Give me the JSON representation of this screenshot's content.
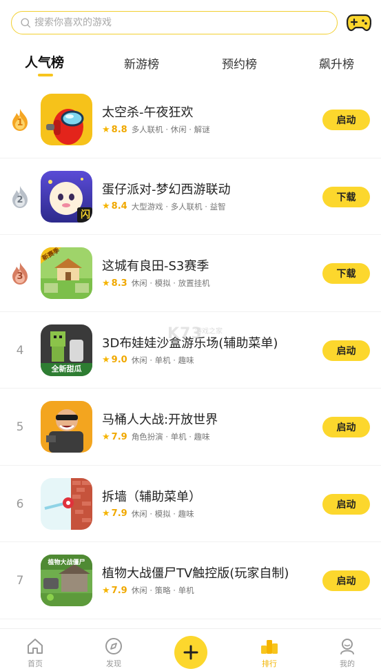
{
  "search": {
    "placeholder": "搜索你喜欢的游戏"
  },
  "tabs": [
    {
      "label": "人气榜",
      "active": true
    },
    {
      "label": "新游榜",
      "active": false
    },
    {
      "label": "预约榜",
      "active": false
    },
    {
      "label": "飙升榜",
      "active": false
    }
  ],
  "games": [
    {
      "rank": "1",
      "name": "太空杀-午夜狂欢",
      "score": "8.8",
      "tags": "多人联机 · 休闲 · 解谜",
      "action": "启动"
    },
    {
      "rank": "2",
      "name": "蛋仔派对-梦幻西游联动",
      "score": "8.4",
      "tags": "大型游戏 · 多人联机 · 益智",
      "action": "下载"
    },
    {
      "rank": "3",
      "name": "这城有良田-S3赛季",
      "score": "8.3",
      "tags": "休闲 · 模拟 · 放置挂机",
      "action": "下载"
    },
    {
      "rank": "4",
      "name": "3D布娃娃沙盒游乐场(辅助菜单)",
      "score": "9.0",
      "tags": "休闲 · 单机 · 趣味",
      "action": "启动"
    },
    {
      "rank": "5",
      "name": "马桶人大战:开放世界",
      "score": "7.9",
      "tags": "角色扮演 · 单机 · 趣味",
      "action": "启动"
    },
    {
      "rank": "6",
      "name": "拆墙（辅助菜单）",
      "score": "7.9",
      "tags": "休闲 · 模拟 · 趣味",
      "action": "启动"
    },
    {
      "rank": "7",
      "name": "植物大战僵尸TV触控版(玩家自制)",
      "score": "7.9",
      "tags": "休闲 · 策略 · 单机",
      "action": "启动"
    }
  ],
  "icon_badges": {
    "game2": "闪",
    "game3": "新赛季",
    "game4": "全新甜瓜",
    "game7": "植物大战僵尸"
  },
  "watermark": {
    "logo": "K73",
    "text": "游戏之家"
  },
  "nav": [
    {
      "label": "首页",
      "icon": "home-icon"
    },
    {
      "label": "发现",
      "icon": "compass-icon"
    },
    {
      "label": "",
      "icon": "plus-icon"
    },
    {
      "label": "排行",
      "icon": "ranking-icon",
      "active": true
    },
    {
      "label": "我的",
      "icon": "profile-icon"
    }
  ],
  "colors": {
    "accent": "#fcd72d",
    "score": "#f0a800",
    "gold": "#f5a623",
    "silver": "#b8bfc8",
    "bronze": "#d77e62"
  }
}
